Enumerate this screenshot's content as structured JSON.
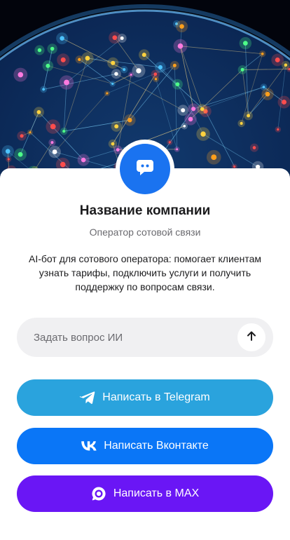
{
  "company": {
    "name": "Название компании",
    "subtitle": "Оператор сотовой связи",
    "description": "AI-бот для сотового оператора: помогает клиентам узнать тарифы, подключить услуги и получить поддержку по вопросам связи."
  },
  "ask": {
    "placeholder": "Задать вопрос ИИ",
    "value": ""
  },
  "buttons": {
    "telegram": "Написать в Telegram",
    "vk": "Написать Вконтакте",
    "max": "Написать в MAX"
  },
  "icons": {
    "avatar": "chat-bubble-icon",
    "send": "arrow-up-icon",
    "telegram": "telegram-icon",
    "vk": "vk-icon",
    "max": "max-icon"
  },
  "colors": {
    "avatar": "#1a73f0",
    "telegram": "#2aa3dd",
    "vk": "#0a76f7",
    "max": "#6a16f5",
    "ask_background": "#f0f0f2"
  }
}
